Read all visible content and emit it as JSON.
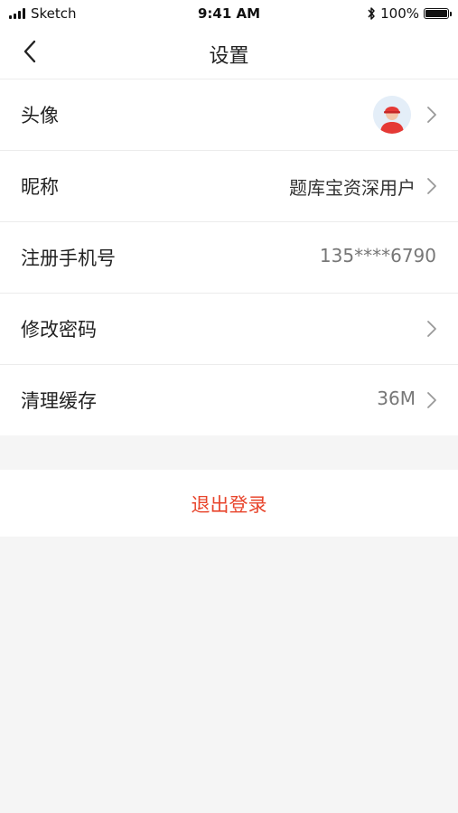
{
  "status_bar": {
    "carrier": "Sketch",
    "time": "9:41 AM",
    "battery": "100%",
    "battery_level": 1.0
  },
  "nav": {
    "title": "设置",
    "back_icon": "chevron-left-icon"
  },
  "settings": {
    "avatar_label": "头像",
    "nickname_label": "昵称",
    "nickname_value": "题库宝资深用户",
    "phone_label": "注册手机号",
    "phone_value": "135****6790",
    "password_label": "修改密码",
    "cache_label": "清理缓存",
    "cache_value": "36M"
  },
  "logout_label": "退出登录",
  "colors": {
    "accent": "#e8452c",
    "background": "#f5f5f5",
    "divider": "#ececec"
  }
}
